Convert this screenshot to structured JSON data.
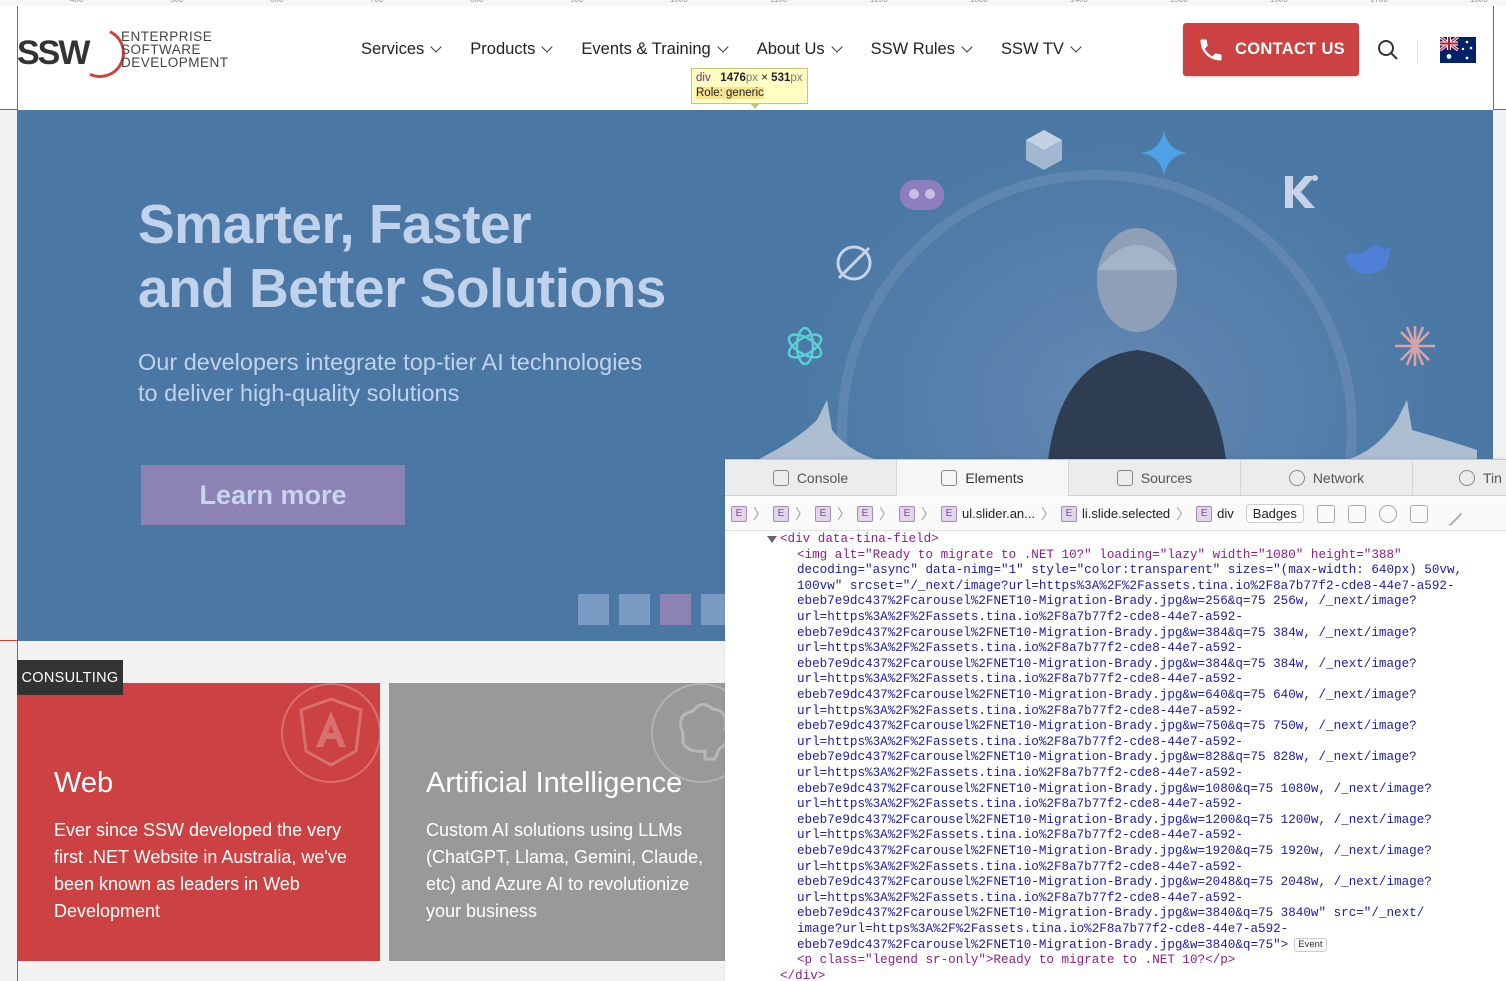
{
  "ruler": [
    "400",
    "500",
    "600",
    "700",
    "800",
    "900",
    "1000",
    "1100",
    "1200",
    "1300",
    "1400",
    "1500",
    "1600",
    "1700",
    "1800"
  ],
  "header": {
    "logo_mark": "SSW",
    "logo_text": [
      "ENTERPRISE",
      "SOFTWARE",
      "DEVELOPMENT"
    ],
    "nav": [
      "Services",
      "Products",
      "Events & Training",
      "About Us",
      "SSW Rules",
      "SSW TV"
    ],
    "contact_label": "CONTACT US",
    "flag": "australia-flag"
  },
  "tooltip": {
    "tag": "div",
    "width": "1476",
    "height": "531",
    "unit": "px",
    "times": "×",
    "role": "Role: generic"
  },
  "hero": {
    "title": "Smarter, Faster\nand Better Solutions",
    "subtitle": "Our developers integrate top-tier AI technologies\nto deliver high-quality solutions",
    "button": "Learn more",
    "slides": 4,
    "active_slide": 3
  },
  "consulting": {
    "tag": "CONSULTING",
    "cards": [
      {
        "title": "Web",
        "text": "Ever since SSW developed the very first .NET Website in Australia, we've been known as leaders in Web Development",
        "icon": "angular-icon"
      },
      {
        "title": "Artificial Intelligence",
        "text": "Custom AI solutions using LLMs (ChatGPT, Llama, Gemini, Claude, etc) and Azure AI to revolutionize your business",
        "icon": "brain-icon"
      }
    ]
  },
  "devtools": {
    "tabs": [
      "Console",
      "Elements",
      "Sources",
      "Network",
      "Tin"
    ],
    "active_tab": "Elements",
    "breadcrumbs": [
      "E",
      "E",
      "E",
      "E",
      "E"
    ],
    "crumb_named": [
      {
        "label": "ul.slider.an..."
      },
      {
        "label": "li.slide.selected"
      },
      {
        "label": "div"
      }
    ],
    "badges": "Badges",
    "code": {
      "div_open": "<div data-tina-field>",
      "img_lines": [
        "<img alt=\"Ready to migrate to .NET 10?\" loading=\"lazy\" width=\"1080\" height=\"388\"",
        "decoding=\"async\" data-nimg=\"1\" style=\"color:transparent\" sizes=\"(max-width: 640px) 50vw,",
        "100vw\" srcset=\"/_next/image?url=https%3A%2F%2Fassets.tina.io%2F8a7b77f2-cde8-44e7-a592-",
        "ebeb7e9dc437%2Fcarousel%2FNET10-Migration-Brady.jpg&w=256&q=75 256w, /_next/image?",
        "url=https%3A%2F%2Fassets.tina.io%2F8a7b77f2-cde8-44e7-a592-",
        "ebeb7e9dc437%2Fcarousel%2FNET10-Migration-Brady.jpg&w=384&q=75 384w, /_next/image?",
        "url=https%3A%2F%2Fassets.tina.io%2F8a7b77f2-cde8-44e7-a592-",
        "ebeb7e9dc437%2Fcarousel%2FNET10-Migration-Brady.jpg&w=384&q=75 384w, /_next/image?",
        "url=https%3A%2F%2Fassets.tina.io%2F8a7b77f2-cde8-44e7-a592-",
        "ebeb7e9dc437%2Fcarousel%2FNET10-Migration-Brady.jpg&w=640&q=75 640w, /_next/image?",
        "url=https%3A%2F%2Fassets.tina.io%2F8a7b77f2-cde8-44e7-a592-",
        "ebeb7e9dc437%2Fcarousel%2FNET10-Migration-Brady.jpg&w=750&q=75 750w, /_next/image?",
        "url=https%3A%2F%2Fassets.tina.io%2F8a7b77f2-cde8-44e7-a592-",
        "ebeb7e9dc437%2Fcarousel%2FNET10-Migration-Brady.jpg&w=828&q=75 828w, /_next/image?",
        "url=https%3A%2F%2Fassets.tina.io%2F8a7b77f2-cde8-44e7-a592-",
        "ebeb7e9dc437%2Fcarousel%2FNET10-Migration-Brady.jpg&w=1080&q=75 1080w, /_next/image?",
        "url=https%3A%2F%2Fassets.tina.io%2F8a7b77f2-cde8-44e7-a592-",
        "ebeb7e9dc437%2Fcarousel%2FNET10-Migration-Brady.jpg&w=1200&q=75 1200w, /_next/image?",
        "url=https%3A%2F%2Fassets.tina.io%2F8a7b77f2-cde8-44e7-a592-",
        "ebeb7e9dc437%2Fcarousel%2FNET10-Migration-Brady.jpg&w=1920&q=75 1920w, /_next/image?",
        "url=https%3A%2F%2Fassets.tina.io%2F8a7b77f2-cde8-44e7-a592-",
        "ebeb7e9dc437%2Fcarousel%2FNET10-Migration-Brady.jpg&w=2048&q=75 2048w, /_next/image?",
        "url=https%3A%2F%2Fassets.tina.io%2F8a7b77f2-cde8-44e7-a592-",
        "ebeb7e9dc437%2Fcarousel%2FNET10-Migration-Brady.jpg&w=3840&q=75 3840w\" src=\"/_next/",
        "image?url=https%3A%2F%2Fassets.tina.io%2F8a7b77f2-cde8-44e7-a592-",
        "ebeb7e9dc437%2Fcarousel%2FNET10-Migration-Brady.jpg&w=3840&q=75\">"
      ],
      "event_badge": "Event",
      "p_line": "<p class=\"legend sr-only\">Ready to migrate to .NET 10?</p>",
      "div_close": "</div>"
    }
  },
  "colors": {
    "brand_red": "#cc4141",
    "hero_blue": "#4a77a4",
    "grey_card": "#999999"
  }
}
